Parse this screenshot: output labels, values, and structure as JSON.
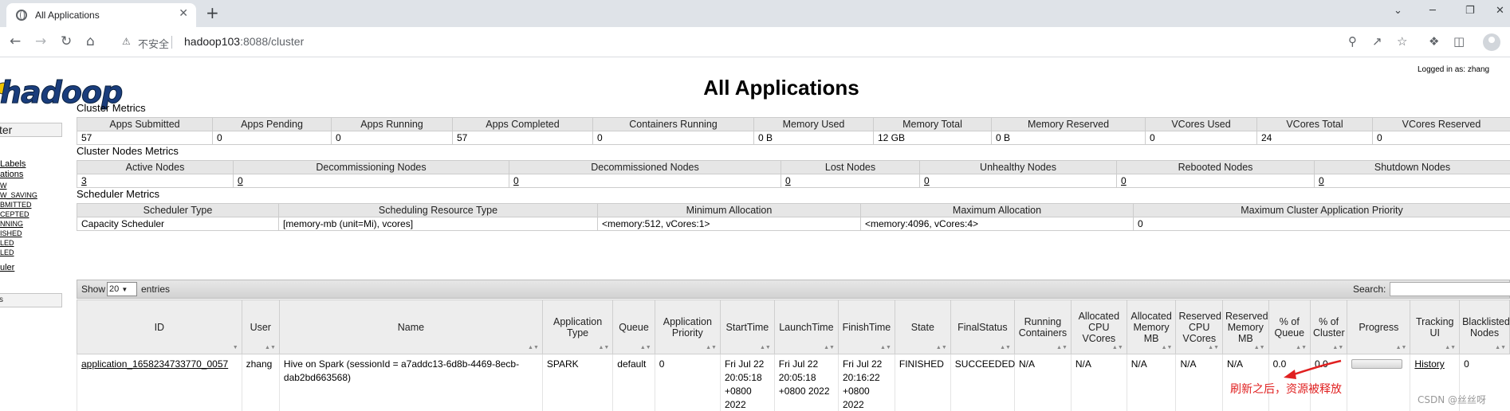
{
  "browser": {
    "tab_title": "All Applications",
    "tab_close": "✕",
    "new_tab": "+",
    "win_minimize": "─",
    "win_restore": "❐",
    "win_close": "✕",
    "win_chevron": "⌄",
    "security_label": "不安全",
    "url_host": "hadoop103",
    "url_rest": ":8088/cluster",
    "icons": [
      "back-icon",
      "forward-icon",
      "reload-icon",
      "home-icon",
      "warning-icon",
      "zoom-icon",
      "share-icon",
      "star-icon",
      "extensions-icon",
      "sidepanel-icon",
      "profile-icon"
    ]
  },
  "header": {
    "logged_in": "Logged in as: zhang",
    "title": "All Applications",
    "logo_text": "hadoop"
  },
  "left_nav": {
    "head": "ter",
    "items": [
      {
        "label": "Labels",
        "size": "normal"
      },
      {
        "label": "ations",
        "size": "normal"
      },
      {
        "label": "W",
        "size": "small"
      },
      {
        "label": "W_SAVING",
        "size": "small"
      },
      {
        "label": "BMITTED",
        "size": "small"
      },
      {
        "label": "CEPTED",
        "size": "small"
      },
      {
        "label": "NNING",
        "size": "small"
      },
      {
        "label": "ISHED",
        "size": "small"
      },
      {
        "label": "LED",
        "size": "small"
      },
      {
        "label": "LED",
        "size": "small"
      },
      {
        "label": "uler",
        "size": "normal"
      }
    ],
    "foot": "s"
  },
  "cluster_metrics": {
    "title": "Cluster Metrics",
    "headers": [
      "Apps Submitted",
      "Apps Pending",
      "Apps Running",
      "Apps Completed",
      "Containers Running",
      "Memory Used",
      "Memory Total",
      "Memory Reserved",
      "VCores Used",
      "VCores Total",
      "VCores Reserved"
    ],
    "values": [
      "57",
      "0",
      "0",
      "57",
      "0",
      "0 B",
      "12 GB",
      "0 B",
      "0",
      "24",
      "0"
    ]
  },
  "cluster_nodes_metrics": {
    "title": "Cluster Nodes Metrics",
    "headers": [
      "Active Nodes",
      "Decommissioning Nodes",
      "Decommissioned Nodes",
      "Lost Nodes",
      "Unhealthy Nodes",
      "Rebooted Nodes",
      "Shutdown Nodes"
    ],
    "values": [
      "3",
      "0",
      "0",
      "0",
      "0",
      "0",
      "0"
    ]
  },
  "scheduler_metrics": {
    "title": "Scheduler Metrics",
    "headers": [
      "Scheduler Type",
      "Scheduling Resource Type",
      "Minimum Allocation",
      "Maximum Allocation",
      "Maximum Cluster Application Priority"
    ],
    "values": [
      "Capacity Scheduler",
      "[memory-mb (unit=Mi), vcores]",
      "<memory:512, vCores:1>",
      "<memory:4096, vCores:4>",
      "0"
    ]
  },
  "apps_table": {
    "show_label": "Show",
    "entries_value": "20",
    "entries_label": "entries",
    "search_label": "Search:",
    "search_value": "",
    "headers": [
      "ID",
      "User",
      "Name",
      "Application Type",
      "Queue",
      "Application Priority",
      "StartTime",
      "LaunchTime",
      "FinishTime",
      "State",
      "FinalStatus",
      "Running Containers",
      "Allocated CPU VCores",
      "Allocated Memory MB",
      "Reserved CPU VCores",
      "Reserved Memory MB",
      "% of Queue",
      "% of Cluster",
      "Progress",
      "Tracking UI",
      "Blacklisted Nodes"
    ],
    "rows": [
      {
        "id": "application_1658234733770_0057",
        "user": "zhang",
        "name": "Hive on Spark (sessionId = a7addc13-6d8b-4469-8ecb-dab2bd663568)",
        "type": "SPARK",
        "queue": "default",
        "priority": "0",
        "start": "Fri Jul 22 20:05:18 +0800 2022",
        "launch": "Fri Jul 22 20:05:18 +0800 2022",
        "finish": "Fri Jul 22 20:16:22 +0800 2022",
        "state": "FINISHED",
        "final_status": "SUCCEEDED",
        "running_containers": "N/A",
        "alloc_cpu": "N/A",
        "alloc_mem": "N/A",
        "res_cpu": "N/A",
        "res_mem": "N/A",
        "pct_queue": "0.0",
        "pct_cluster": "0.0",
        "progress_pct": 0,
        "tracking": "History",
        "blacklisted": "0"
      }
    ]
  },
  "annotation": {
    "text": "刷新之后，资源被释放",
    "color": "#e02020"
  },
  "watermark": "CSDN @丝丝呀"
}
